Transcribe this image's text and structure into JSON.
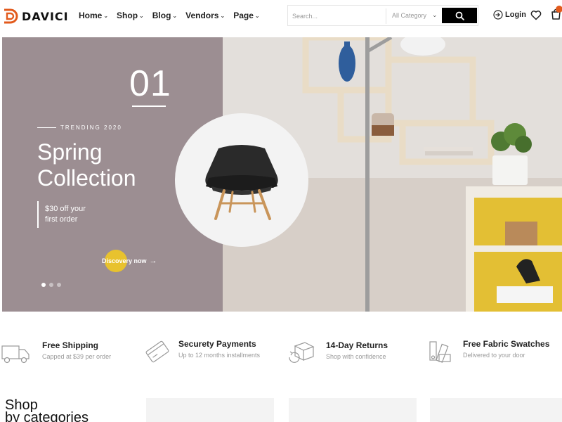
{
  "brand": {
    "name": "DAVICI",
    "accent": "#e25a1c"
  },
  "nav": {
    "items": [
      {
        "label": "Home"
      },
      {
        "label": "Shop"
      },
      {
        "label": "Blog"
      },
      {
        "label": "Vendors"
      },
      {
        "label": "Page"
      }
    ]
  },
  "search": {
    "placeholder": "Search...",
    "category": "All Category",
    "button_icon": "search-icon"
  },
  "account": {
    "login_label": "Login",
    "wishlist_icon": "heart-icon",
    "cart_icon": "cart-icon"
  },
  "hero": {
    "slide_number": "01",
    "tagline": "TRENDING 2020",
    "title_line1": "Spring",
    "title_line2": "Collection",
    "offer_line1": "$30 off your",
    "offer_line2": "first order",
    "cta": "Discovery now",
    "cta_arrow": "→",
    "slides_total": 3,
    "active_slide": 1,
    "colors": {
      "panel": "#9c8e92",
      "cta_dot": "#e8c22e"
    }
  },
  "features": [
    {
      "title": "Free Shipping",
      "subtitle": "Capped at $39 per order",
      "icon": "truck-icon"
    },
    {
      "title": "Securety Payments",
      "subtitle": "Up to 12 months installments",
      "icon": "credit-card-icon"
    },
    {
      "title": "14-Day Returns",
      "subtitle": "Shop with confidence",
      "icon": "return-box-icon"
    },
    {
      "title": "Free Fabric Swatches",
      "subtitle": "Delivered to your door",
      "icon": "swatches-icon"
    }
  ],
  "categories": {
    "title_line1": "Shop",
    "title_line2": "by categories"
  }
}
